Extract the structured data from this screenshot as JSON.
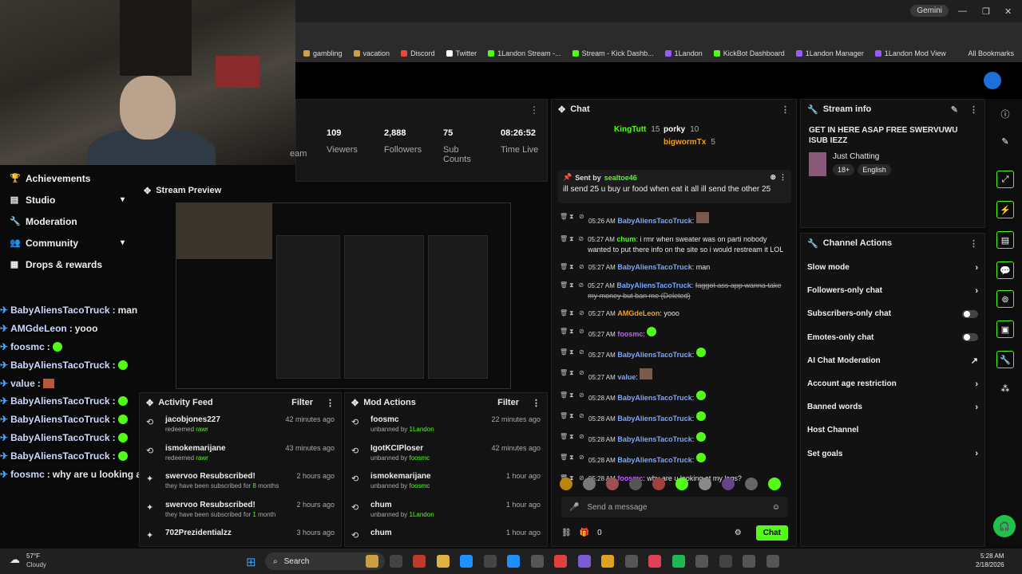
{
  "browser": {
    "gemini_label": "Gemini",
    "bookmarks": [
      {
        "label": "gambling",
        "color": "#caa04a"
      },
      {
        "label": "vacation",
        "color": "#caa04a"
      },
      {
        "label": "Discord",
        "color": "#e64a3a"
      },
      {
        "label": "Twitter",
        "color": "#ffffff"
      },
      {
        "label": "1Landon Stream -...",
        "color": "#53fc18"
      },
      {
        "label": "Stream - Kick Dashb...",
        "color": "#53fc18"
      },
      {
        "label": "1Landon",
        "color": "#9b59ff"
      },
      {
        "label": "KickBot Dashboard",
        "color": "#53fc18"
      },
      {
        "label": "1Landon Manager",
        "color": "#9b59ff"
      },
      {
        "label": "1Landon Mod View",
        "color": "#9b59ff"
      }
    ],
    "all_bookmarks": "All Bookmarks"
  },
  "nav": {
    "items": [
      {
        "label": "Achievements",
        "icon": "trophy-icon",
        "glyph": "🏆",
        "chevron": false
      },
      {
        "label": "Studio",
        "icon": "studio-icon",
        "glyph": "▤",
        "chevron": true
      },
      {
        "label": "Moderation",
        "icon": "wrench-icon",
        "glyph": "🔧",
        "chevron": false
      },
      {
        "label": "Community",
        "icon": "users-icon",
        "glyph": "👥",
        "chevron": true
      },
      {
        "label": "Drops & rewards",
        "icon": "gift-icon",
        "glyph": "▦",
        "chevron": false
      }
    ]
  },
  "overlay_chat": [
    {
      "user": "BabyAliensTacoTruck",
      "text": "man",
      "emote": ""
    },
    {
      "user": "AMGdeLeon",
      "text": "yooo",
      "emote": ""
    },
    {
      "user": "foosmc",
      "text": "",
      "emote": "green"
    },
    {
      "user": "BabyAliensTacoTruck",
      "text": "",
      "emote": "green"
    },
    {
      "user": "value",
      "text": "",
      "emote": "red"
    },
    {
      "user": "BabyAliensTacoTruck",
      "text": "",
      "emote": "green"
    },
    {
      "user": "BabyAliensTacoTruck",
      "text": "",
      "emote": "green"
    },
    {
      "user": "BabyAliensTacoTruck",
      "text": "",
      "emote": "green"
    },
    {
      "user": "BabyAliensTacoTruck",
      "text": "",
      "emote": "green"
    },
    {
      "user": "foosmc",
      "text": "why are u looking at my logs?",
      "emote": ""
    }
  ],
  "stats": {
    "viewers": {
      "value": "109",
      "label": "Viewers"
    },
    "followers": {
      "value": "2,888",
      "label": "Followers"
    },
    "subs": {
      "value": "75",
      "label": "Sub Counts"
    },
    "time": {
      "value": "08:26:52",
      "label": "Time Live"
    },
    "partial_label": "eam"
  },
  "preview": {
    "title": "Stream Preview"
  },
  "activity": {
    "title": "Activity Feed",
    "filter": "Filter",
    "items": [
      {
        "name": "jacobjones227",
        "detail_pre": "redeemed ",
        "detail_hl": "rawr",
        "detail_post": "",
        "time": "42 minutes ago",
        "icon": "redeem-icon",
        "glyph": "⟲"
      },
      {
        "name": "ismokemarijane",
        "detail_pre": "redeemed ",
        "detail_hl": "rawr",
        "detail_post": "",
        "time": "43 minutes ago",
        "icon": "redeem-icon",
        "glyph": "⟲"
      },
      {
        "name": "swervoo Resubscribed!",
        "detail_pre": "they have been subscribed for ",
        "detail_hl": "8",
        "detail_post": " months",
        "time": "2 hours ago",
        "icon": "star-icon",
        "glyph": "✦"
      },
      {
        "name": "swervoo Resubscribed!",
        "detail_pre": "they have been subscribed for ",
        "detail_hl": "1",
        "detail_post": " month",
        "time": "2 hours ago",
        "icon": "star-icon",
        "glyph": "✦"
      },
      {
        "name": "702Prezidentialzz",
        "detail_pre": "",
        "detail_hl": "",
        "detail_post": "",
        "time": "3 hours ago",
        "icon": "star-icon",
        "glyph": "✦"
      }
    ]
  },
  "mod_actions": {
    "title": "Mod Actions",
    "filter": "Filter",
    "items": [
      {
        "name": "foosmc",
        "detail_pre": "unbanned by ",
        "detail_hl": "1Landon",
        "time": "22 minutes ago"
      },
      {
        "name": "IgotKCIPloser",
        "detail_pre": "unbanned by ",
        "detail_hl": "foosmc",
        "time": "42 minutes ago"
      },
      {
        "name": "ismokemarijane",
        "detail_pre": "unbanned by ",
        "detail_hl": "foosmc",
        "time": "1 hour ago"
      },
      {
        "name": "chum",
        "detail_pre": "unbanned by ",
        "detail_hl": "1Landon",
        "time": "1 hour ago"
      },
      {
        "name": "chum",
        "detail_pre": "",
        "detail_hl": "",
        "time": "1 hour ago"
      }
    ]
  },
  "chat": {
    "title": "Chat",
    "leaders": [
      {
        "name": "KingTutt",
        "count": "15",
        "color": "#53fc18"
      },
      {
        "name": "porky",
        "count": "10",
        "color": "#ffffff"
      },
      {
        "name": "bigwormTx",
        "count": "5",
        "color": "#f0a020"
      }
    ],
    "pinned": {
      "label": "Sent by",
      "user": "sealtoe46",
      "text": "ill send 25 u buy ur food when eat it all ill send the other 25"
    },
    "messages": [
      {
        "time": "05:26 AM",
        "user": "BabyAliensTacoTruck",
        "ucls": "",
        "text": "",
        "emote": "img",
        "wrap": false,
        "del": false
      },
      {
        "time": "05:27 AM",
        "user": "chum",
        "ucls": "c",
        "text": "i rmr when sweater was on parti nobody wanted to put there info on the site so i would restream it LOL",
        "emote": "",
        "wrap": true,
        "del": false
      },
      {
        "time": "05:27 AM",
        "user": "BabyAliensTacoTruck",
        "ucls": "",
        "text": "man",
        "emote": "",
        "wrap": false,
        "del": false
      },
      {
        "time": "05:27 AM",
        "user": "BabyAliensTacoTruck",
        "ucls": "",
        "text": "faggot ass app wanna take my money but ban me (Deleted)",
        "emote": "",
        "wrap": true,
        "del": true
      },
      {
        "time": "05:27 AM",
        "user": "AMGdeLeon",
        "ucls": "o",
        "text": "yooo",
        "emote": "",
        "wrap": false,
        "del": false
      },
      {
        "time": "05:27 AM",
        "user": "foosmc",
        "ucls": "p",
        "text": "",
        "emote": "green",
        "wrap": false,
        "del": false
      },
      {
        "time": "05:27 AM",
        "user": "BabyAliensTacoTruck",
        "ucls": "",
        "text": "",
        "emote": "green",
        "wrap": false,
        "del": false
      },
      {
        "time": "05:27 AM",
        "user": "value",
        "ucls": "",
        "text": "",
        "emote": "img",
        "wrap": false,
        "del": false
      },
      {
        "time": "05:28 AM",
        "user": "BabyAliensTacoTruck",
        "ucls": "",
        "text": "",
        "emote": "green",
        "wrap": false,
        "del": false
      },
      {
        "time": "05:28 AM",
        "user": "BabyAliensTacoTruck",
        "ucls": "",
        "text": "",
        "emote": "green",
        "wrap": false,
        "del": false
      },
      {
        "time": "05:28 AM",
        "user": "BabyAliensTacoTruck",
        "ucls": "",
        "text": "",
        "emote": "green",
        "wrap": false,
        "del": false
      },
      {
        "time": "05:28 AM",
        "user": "BabyAliensTacoTruck",
        "ucls": "",
        "text": "",
        "emote": "green",
        "wrap": false,
        "del": false
      },
      {
        "time": "05:28 AM",
        "user": "foosmc",
        "ucls": "p",
        "text": "why are u looking at my logs?",
        "emote": "",
        "wrap": false,
        "del": false
      }
    ],
    "placeholder": "Send a message",
    "points": "0",
    "send": "Chat"
  },
  "stream_info": {
    "title": "Stream info",
    "stream_title": "GET IN HERE ASAP FREE SWERVUWU ISUB IEZZ",
    "category": "Just Chatting",
    "tags": [
      "18+",
      "English"
    ]
  },
  "channel_actions": {
    "title": "Channel Actions",
    "items": [
      {
        "label": "Slow mode",
        "ctrl": "chevron"
      },
      {
        "label": "Followers-only chat",
        "ctrl": "chevron"
      },
      {
        "label": "Subscribers-only chat",
        "ctrl": "toggle"
      },
      {
        "label": "Emotes-only chat",
        "ctrl": "toggle"
      },
      {
        "label": "AI Chat Moderation",
        "ctrl": "external"
      },
      {
        "label": "Account age restriction",
        "ctrl": "chevron"
      },
      {
        "label": "Banned words",
        "ctrl": "chevron"
      },
      {
        "label": "Host Channel",
        "ctrl": "none"
      },
      {
        "label": "Set goals",
        "ctrl": "chevron"
      }
    ]
  },
  "taskbar": {
    "weather_temp": "57°F",
    "weather_desc": "Cloudy",
    "search": "Search",
    "time": "5:28 AM",
    "date": "2/18/2026"
  },
  "colors": {
    "accent": "#53fc18",
    "panel": "#121212"
  }
}
